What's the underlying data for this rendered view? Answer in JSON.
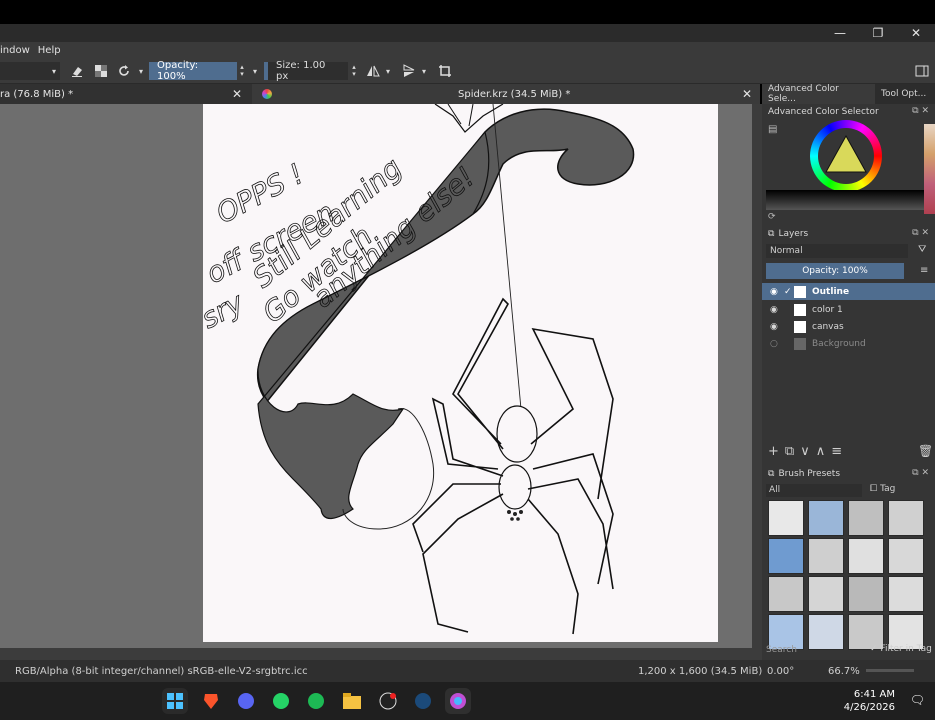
{
  "menubar": {
    "items": [
      "indow",
      "Help"
    ]
  },
  "toolbar": {
    "opacity_label": "Opacity: 100%",
    "size_label": "Size: 1.00 px"
  },
  "tabs": [
    {
      "label": "ra (76.8 MiB) *"
    },
    {
      "label": "Spider.krz (34.5 MiB) *"
    }
  ],
  "canvas_text": {
    "line1": "OPPS !",
    "line2": "off screen",
    "line3": "Still Learning",
    "line4": "sry",
    "line5": "Go watch",
    "line6": "anything else!"
  },
  "dock": {
    "tabs": [
      "Advanced Color Sele...",
      "Tool Opt..."
    ],
    "color_selector_title": "Advanced Color Selector",
    "layers_title": "Layers",
    "blend_mode": "Normal",
    "layer_opacity": "Opacity: 100%",
    "layers": [
      {
        "name": "Outline",
        "active": true
      },
      {
        "name": "color 1",
        "active": false
      },
      {
        "name": "canvas",
        "active": false
      },
      {
        "name": "Background",
        "active": false
      }
    ],
    "brush_presets_title": "Brush Presets",
    "brush_filter": "All",
    "tag_label": "Tag",
    "search_placeholder": "Search",
    "filter_in_tag": "Filter in Tag"
  },
  "status": {
    "color_space": "RGB/Alpha (8-bit integer/channel)  sRGB-elle-V2-srgbtrc.icc",
    "dimensions": "1,200 x 1,600 (34.5 MiB)",
    "rotation": "0.00°",
    "zoom": "66.7%"
  },
  "clock": {
    "time": "6:41 AM",
    "date": "4/26/2026"
  },
  "colors": {
    "accent": "#4f6d8f",
    "panel": "#353535",
    "canvas_bg": "#faf7f9",
    "dark_fill": "#5a5a5a"
  },
  "taskbar_icons": [
    "windows-start-icon",
    "brave-icon",
    "discord-icon",
    "whatsapp-icon",
    "spotify-icon",
    "file-explorer-icon",
    "obs-icon",
    "steam-icon",
    "krita-icon"
  ]
}
